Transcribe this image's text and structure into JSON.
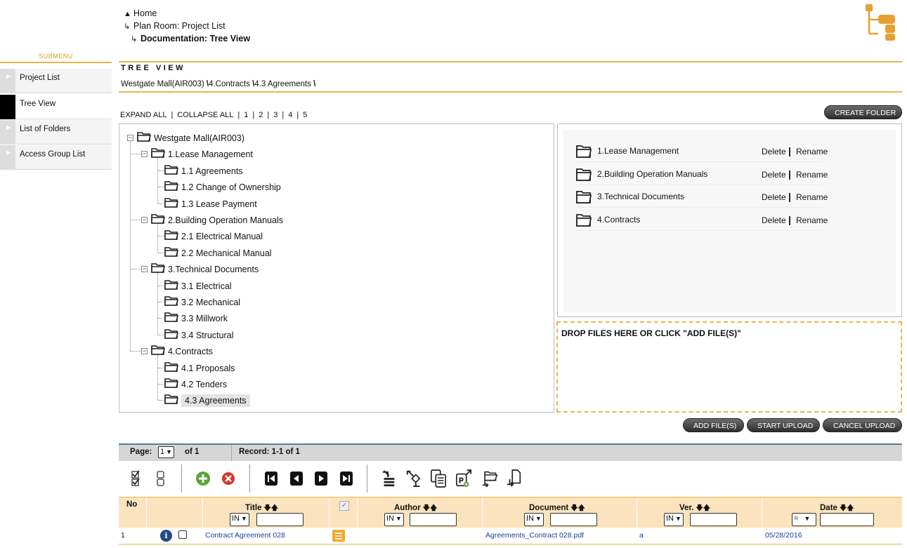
{
  "breadcrumb": {
    "home": "Home",
    "project_list": "Plan Room: Project List",
    "current": "Documentation: Tree View"
  },
  "submenu": {
    "title": "SUBMENU",
    "items": [
      {
        "label": "Project List",
        "active": false
      },
      {
        "label": "Tree View",
        "active": true
      },
      {
        "label": "List of Folders",
        "active": false
      },
      {
        "label": "Access Group List",
        "active": false
      }
    ]
  },
  "tree_view": {
    "heading": "TREE VIEW",
    "path": [
      "Westgate Mall(AIR003)",
      "4.Contracts",
      "4.3 Agreements"
    ],
    "path_sep": "\\",
    "expand_all": "EXPAND ALL",
    "collapse_all": "COLLAPSE ALL",
    "levels": [
      "1",
      "2",
      "3",
      "4",
      "5"
    ],
    "sep": "|",
    "create_folder": "CREATE FOLDER",
    "root": "Westgate Mall(AIR003)",
    "nodes": [
      {
        "label": "1.Lease Management",
        "children": [
          "1.1 Agreements",
          "1.2 Change of Ownership",
          "1.3 Lease Payment"
        ]
      },
      {
        "label": "2.Building Operation Manuals",
        "children": [
          "2.1 Electrical Manual",
          "2.2 Mechanical Manual"
        ]
      },
      {
        "label": "3.Technical Documents",
        "children": [
          "3.1 Electrical",
          "3.2 Mechanical",
          "3.3 Millwork",
          "3.4 Structural"
        ]
      },
      {
        "label": "4.Contracts",
        "children": [
          "4.1 Proposals",
          "4.2 Tenders",
          "4.3 Agreements"
        ]
      }
    ],
    "selected": "4.3 Agreements"
  },
  "folder_list": {
    "delete_label": "Delete",
    "rename_label": "Rename",
    "bar": "|",
    "folders": [
      "1.Lease Management",
      "2.Building Operation Manuals",
      "3.Technical Documents",
      "4.Contracts"
    ]
  },
  "upload": {
    "drop_text": "DROP FILES HERE OR CLICK \"ADD FILE(S)\"",
    "add_files": "ADD FILE(S)",
    "start_upload": "START UPLOAD",
    "cancel_upload": "CANCEL UPLOAD"
  },
  "pager": {
    "page_label": "Page:",
    "page_value": "1",
    "of_label": "of 1",
    "record_label": "Record: 1-1 of 1"
  },
  "toolbar_icons": [
    "check-all-icon",
    "uncheck-all-icon",
    "add-icon",
    "delete-icon",
    "first-page-icon",
    "prev-page-icon",
    "next-page-icon",
    "last-page-icon",
    "list-export-icon",
    "tree-export-icon",
    "copy-icon",
    "pdf-export-icon",
    "move-folder-icon",
    "move-file-icon"
  ],
  "table": {
    "no_header": "No",
    "columns": [
      {
        "name": "Title",
        "op": "IN"
      },
      {
        "name": "Author",
        "op": "IN"
      },
      {
        "name": "Document",
        "op": "IN"
      },
      {
        "name": "Ver.",
        "op": "IN"
      },
      {
        "name": "Date",
        "op": "="
      }
    ],
    "rows": [
      {
        "no": "1",
        "title": "Contract Agreement 028",
        "author": "",
        "document": "Agreements_Contract 028.pdf",
        "version": "a",
        "date": "05/28/2016"
      }
    ]
  },
  "colors": {
    "accent": "#e8b64a",
    "header_bg": "#fbe4bd",
    "link": "#1a3e9e"
  }
}
